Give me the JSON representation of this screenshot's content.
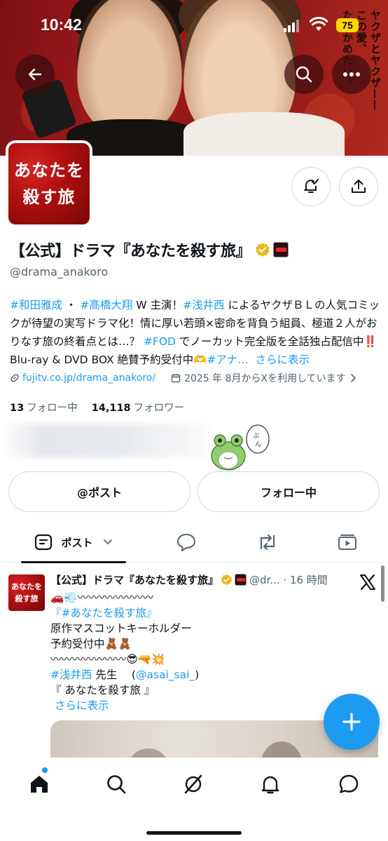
{
  "status_bar": {
    "time": "10:42",
    "battery": "75"
  },
  "banner": {
    "vertical_text": [
      "ヤクザとヤクザ——",
      "この愛、",
      "たしかめたい。"
    ]
  },
  "avatar": {
    "line1": "あなたを",
    "line2": "殺す旅"
  },
  "profile": {
    "name": "【公式】ドラマ『あなたを殺す旅』",
    "handle": "@drama_anakoro",
    "bio": {
      "tag1": "#和田雅成",
      "sep1": " ・ ",
      "tag2": "#髙橋大翔",
      "text1": " W 主演！",
      "tag3": "#浅井西",
      "text2": " によるヤクザＢＬの人気コミックが待望の実写ドラマ化！情に厚い若頭×密命を背負う組員、極道２人がおりなす旅の終着点とは…？ ",
      "tag4": "#FOD",
      "text3": " でノーカット完全版を全話独占配信中‼️ Blu-ray & DVD BOX 絶賛予約受付中🫶",
      "tag5": "#アナ…",
      "more": "さらに表示"
    },
    "link": "fujitv.co.jp/drama_anakoro/",
    "joined": "2025 年 8月からXを利用しています",
    "following_count": "13",
    "following_label": "フォロー中",
    "followers_count": "14,118",
    "followers_label": "フォロワー"
  },
  "buttons": {
    "post": "@ポスト",
    "following": "フォロー中"
  },
  "tabs": {
    "posts_label": "ポスト"
  },
  "post": {
    "avatar_line1": "あなたを",
    "avatar_line2": "殺す旅",
    "name": "【公式】ドラマ『あなたを殺す旅』",
    "handle_time": "@dr... · 16 時間",
    "line1": "🚗💨〰〰〰〰〰〰〰",
    "line2_tag": "『#あなたを殺す旅』",
    "line3": "原作マスコットキーホルダー",
    "line4": "予約受付中🧸🧸",
    "line5": "〰〰〰〰〰〰〰😎🔫💥",
    "line6_tag": "#浅井西",
    "line6_text": " 先生 　(",
    "line6_mention": "@asai_sai_",
    "line6_close": ")",
    "line7": "『 あなたを殺す旅 』",
    "more": "さらに表示"
  },
  "colors": {
    "accent": "#1d9bf0",
    "text": "#0f1419",
    "muted": "#536471",
    "brand_red": "#b01010"
  }
}
